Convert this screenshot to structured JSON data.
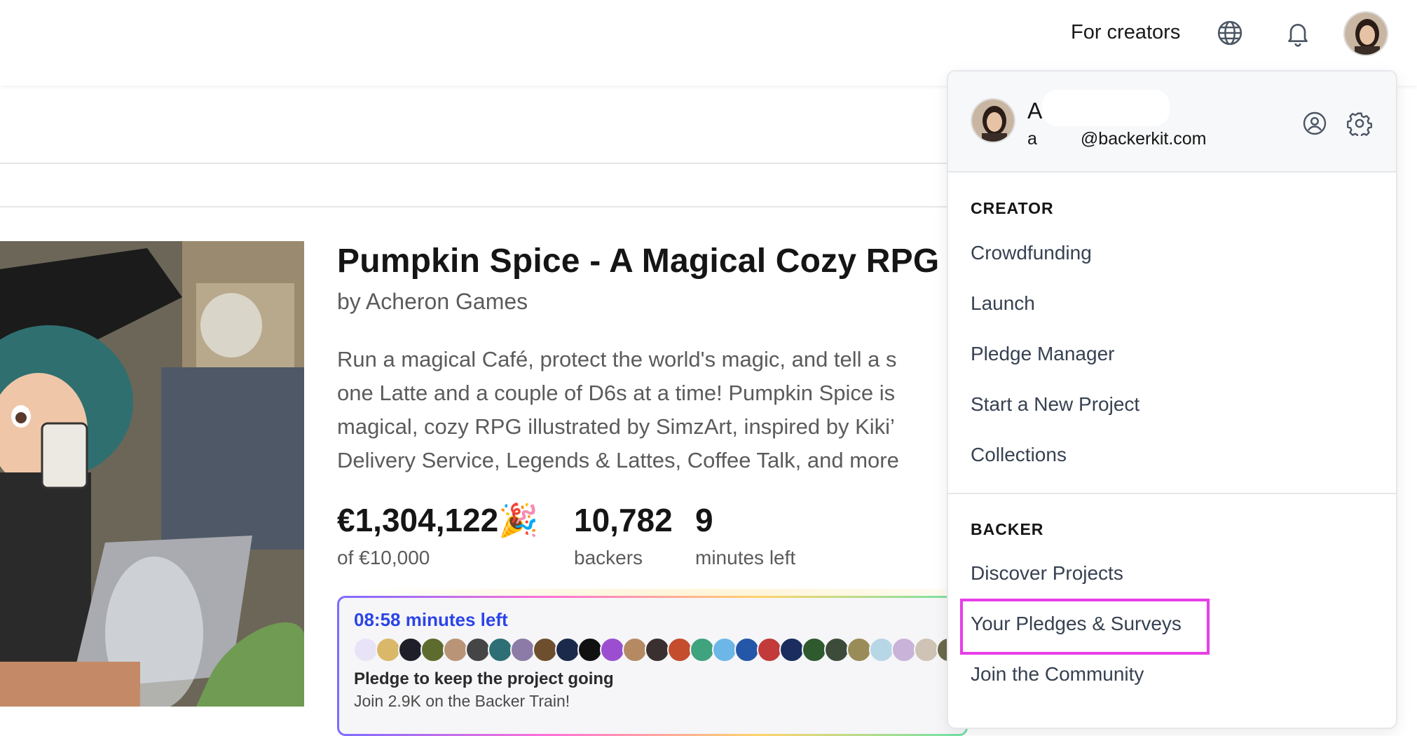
{
  "nav": {
    "for_creators": "For creators",
    "globe_icon": "globe-icon",
    "bell_icon": "bell-icon",
    "avatar_icon": "user-avatar"
  },
  "project": {
    "title": "Pumpkin Spice - A Magical Cozy RPG",
    "by": "by Acheron Games",
    "description_lines": [
      "Run a magical Café, protect the world's magic, and tell a s",
      "one Latte and a couple of D6s at a time! Pumpkin Spice is",
      "magical, cozy RPG illustrated by SimzArt, inspired by Kiki’",
      "Delivery Service, Legends & Lattes, Coffee Talk, and more"
    ],
    "stats": {
      "amount": "€1,304,122",
      "amount_emoji": "🎉",
      "goal": "of €10,000",
      "backers_value": "10,782",
      "backers_label": "backers",
      "time_value": "9",
      "time_label": "minutes left"
    }
  },
  "train": {
    "time_left": "08:58 minutes left",
    "cta": "Pledge to keep the project going",
    "join": "Join 2.9K on the Backer Train!"
  },
  "dropdown": {
    "name_initial": "A",
    "email_initial": "a",
    "email_domain": "@backerkit.com",
    "profile_icon": "user-circle-icon",
    "settings_icon": "gear-icon",
    "creator_section": "CREATOR",
    "creator_items": [
      "Crowdfunding",
      "Launch",
      "Pledge Manager",
      "Start a New Project",
      "Collections"
    ],
    "backer_section": "BACKER",
    "backer_items": [
      "Discover Projects",
      "Your Pledges & Surveys",
      "Join the Community"
    ],
    "highlight_color": "#e83ee8"
  }
}
